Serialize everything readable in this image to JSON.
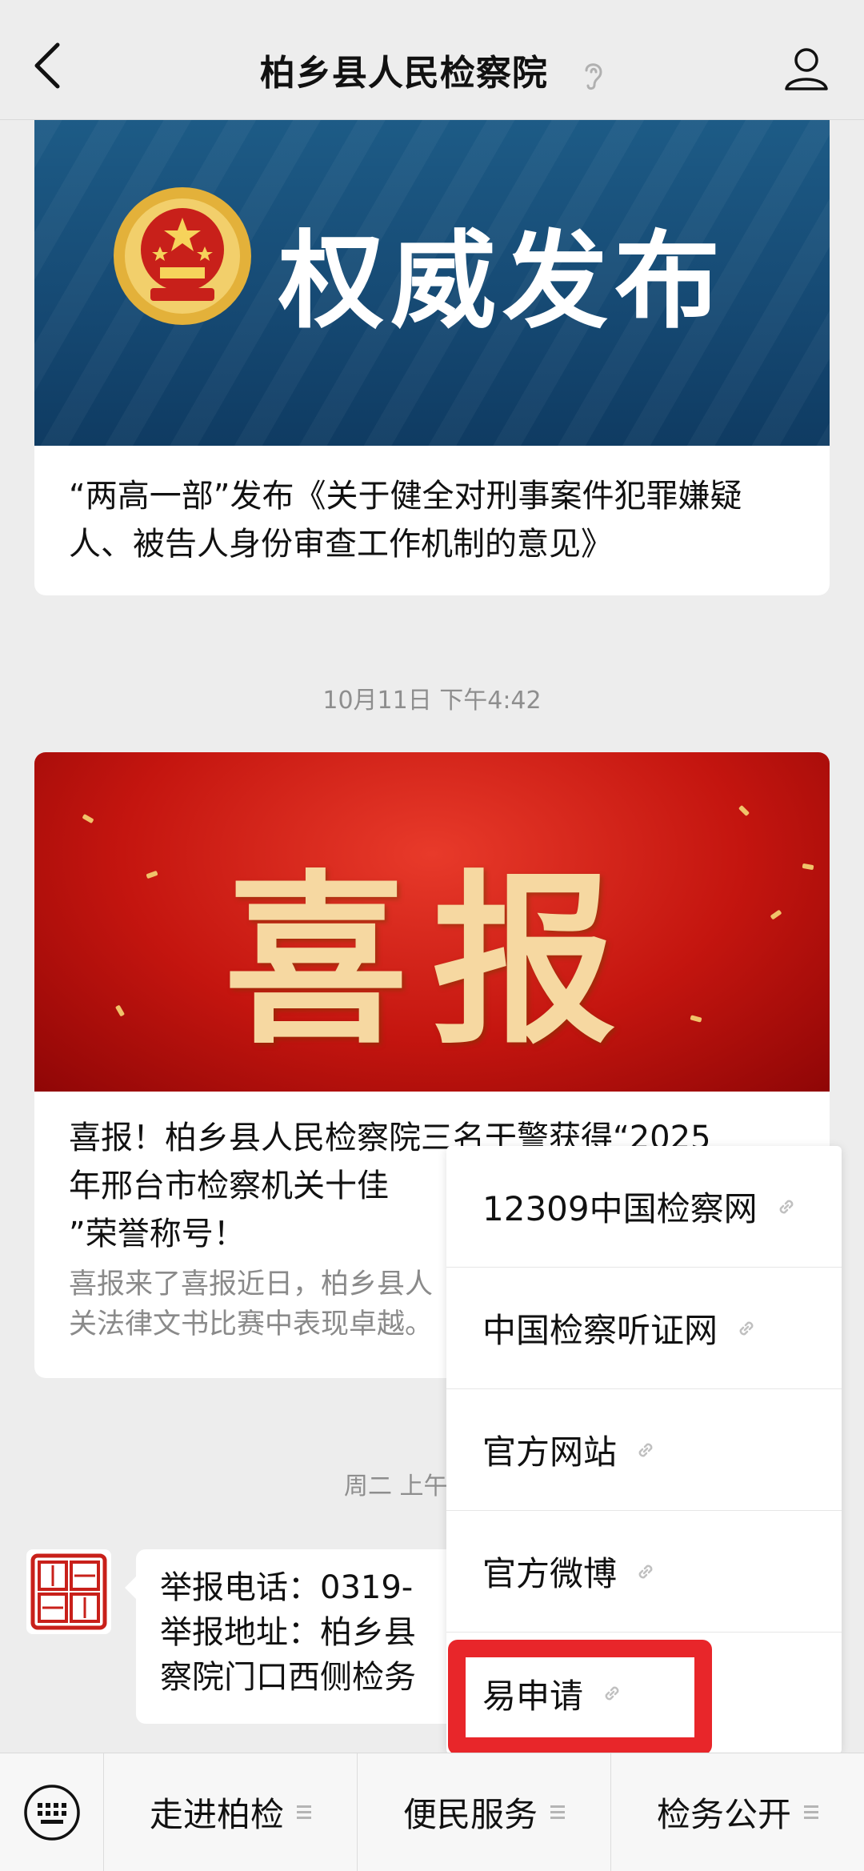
{
  "header": {
    "title": "柏乡县人民检察院"
  },
  "articles": [
    {
      "banner_text": "权威发布",
      "title": "“两高一部”发布《关于健全对刑事案件犯罪嫌疑人、被告人身份审查工作机制的意见》"
    },
    {
      "banner_text": "喜报",
      "title_lines": [
        "喜报！柏乡县人民检察院三名干警获得“2025",
        "年邢台市检察机关十佳",
        "”荣誉称号！"
      ],
      "desc_lines": [
        "喜报来了喜报近日，柏乡县人",
        "关法律文书比赛中表现卓越。"
      ]
    }
  ],
  "timestamps": {
    "t1": "10月11日 下午4:42",
    "t2": "周二 上午"
  },
  "message": {
    "lines": [
      "举报电话：0319-",
      "举报地址：柏乡县",
      "察院门口西侧检务"
    ]
  },
  "popup_menu": {
    "items": [
      "12309中国检察网",
      "中国检察听证网",
      "官方网站",
      "官方微博",
      "易申请"
    ],
    "highlighted": "易申请",
    "highlight_color": "#e8262a"
  },
  "bottom_bar": {
    "tabs": [
      "走进柏检",
      "便民服务",
      "检务公开"
    ]
  },
  "colors": {
    "banner1_bg": "#164a74",
    "banner2_bg": "#c4150f"
  }
}
